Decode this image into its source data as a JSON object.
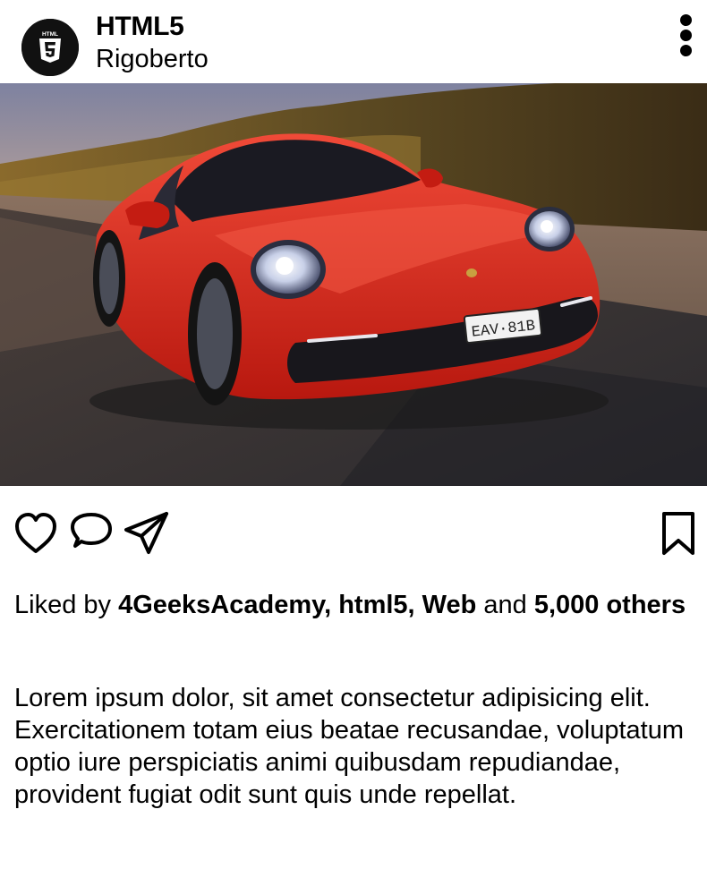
{
  "header": {
    "account_name": "HTML5",
    "account_subtitle": "Rigoberto",
    "avatar_icon": "html5-logo-icon",
    "more_icon": "more-vertical-icon"
  },
  "photo": {
    "license_plate": "EAV·81B",
    "car_color": "#e02a20"
  },
  "actions": {
    "like_icon": "heart-icon",
    "comment_icon": "comment-icon",
    "share_icon": "send-icon",
    "save_icon": "bookmark-icon"
  },
  "likes": {
    "prefix": "Liked by ",
    "users": "4GeeksAcademy, html5, Web",
    "connector": " and ",
    "others": "5,000 others"
  },
  "caption": {
    "text": "Lorem ipsum dolor, sit amet consectetur adipisicing elit. Exercitationem totam eius beatae recusandae, voluptatum optio iure perspiciatis animi quibusdam repudiandae, provident fugiat odit sunt quis unde repellat."
  }
}
